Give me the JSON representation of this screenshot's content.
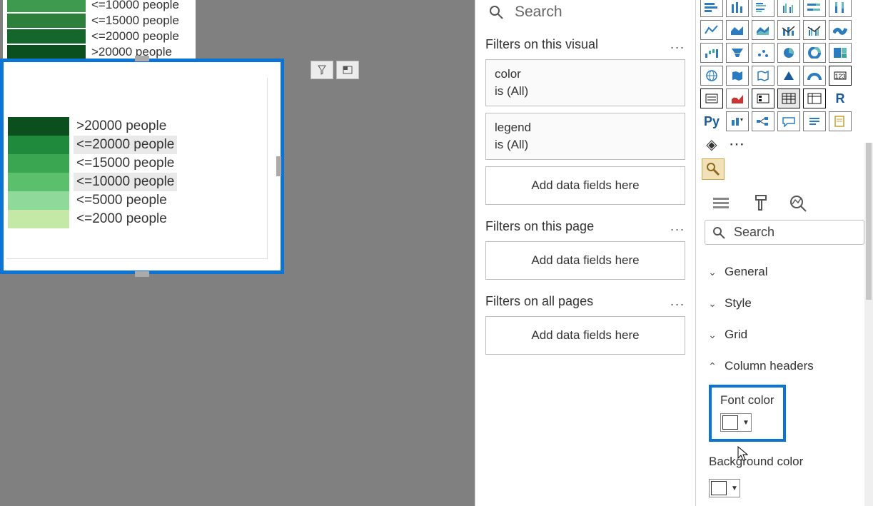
{
  "legend_top": {
    "rows": [
      {
        "label": "<=10000 people",
        "color": "#3e9a4f"
      },
      {
        "label": "<=15000 people",
        "color": "#2d7f3c"
      },
      {
        "label": "<=20000 people",
        "color": "#14662a"
      },
      {
        "label": ">20000 people",
        "color": "#0b4f1f"
      }
    ]
  },
  "selected_visual": {
    "rows": [
      {
        "label": ">20000 people",
        "color": "#0b4f1f",
        "highlight": false
      },
      {
        "label": "<=20000 people",
        "color": "#1f8a3c",
        "highlight": true
      },
      {
        "label": "<=15000 people",
        "color": "#3aa651",
        "highlight": false
      },
      {
        "label": "<=10000 people",
        "color": "#5cbf6c",
        "highlight": true
      },
      {
        "label": "<=5000 people",
        "color": "#8fd99a",
        "highlight": false
      },
      {
        "label": "<=2000 people",
        "color": "#c4e8a6",
        "highlight": false
      }
    ]
  },
  "filters_pane": {
    "search_placeholder": "Search",
    "section_visual_title": "Filters on this visual",
    "filters_visual": [
      {
        "field": "color",
        "summary": "is (All)"
      },
      {
        "field": "legend",
        "summary": "is (All)"
      }
    ],
    "add_fields_label": "Add data fields here",
    "section_page_title": "Filters on this page",
    "section_allpages_title": "Filters on all pages"
  },
  "viz_pane": {
    "search_placeholder": "Search",
    "accordion": {
      "general": "General",
      "style": "Style",
      "grid": "Grid",
      "column_headers": "Column headers"
    },
    "font_color": {
      "label": "Font color",
      "value": "#FFFFFF"
    },
    "background_color": {
      "label": "Background color",
      "value": "#FFFFFF"
    }
  }
}
